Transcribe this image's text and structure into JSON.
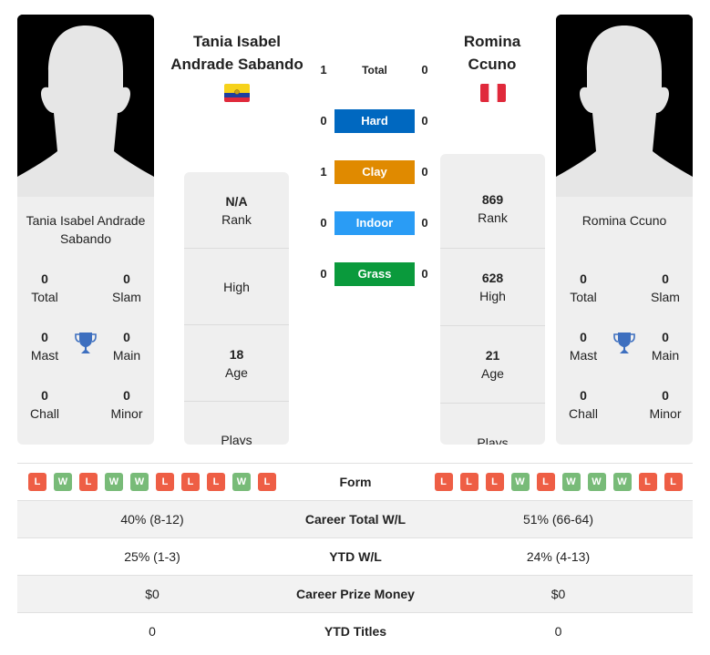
{
  "players": [
    {
      "head_name": "Tania Isabel Andrade Sabando",
      "head_name_lines": [
        "Tania Isabel",
        "Andrade Sabando"
      ],
      "card_name": "Tania Isabel Andrade Sabando",
      "country": "Ecuador",
      "flag_icon": "ecuador-flag-icon",
      "titles": {
        "total": {
          "value": "0",
          "label": "Total"
        },
        "slam": {
          "value": "0",
          "label": "Slam"
        },
        "mast": {
          "value": "0",
          "label": "Mast"
        },
        "main": {
          "value": "0",
          "label": "Main"
        },
        "chall": {
          "value": "0",
          "label": "Chall"
        },
        "minor": {
          "value": "0",
          "label": "Minor"
        }
      },
      "stats": {
        "rank": {
          "value": "N/A",
          "label": "Rank"
        },
        "high": {
          "value": "",
          "label": "High"
        },
        "age": {
          "value": "18",
          "label": "Age"
        },
        "plays": {
          "value": "",
          "label": "Plays"
        }
      },
      "form": [
        "L",
        "W",
        "L",
        "W",
        "W",
        "L",
        "L",
        "L",
        "W",
        "L"
      ],
      "career_wl": "40% (8-12)",
      "ytd_wl": "25% (1-3)",
      "prize_money": "$0",
      "ytd_titles": "0"
    },
    {
      "head_name": "Romina Ccuno",
      "head_name_lines": [
        "Romina",
        "Ccuno"
      ],
      "card_name": "Romina Ccuno",
      "country": "Peru",
      "flag_icon": "peru-flag-icon",
      "titles": {
        "total": {
          "value": "0",
          "label": "Total"
        },
        "slam": {
          "value": "0",
          "label": "Slam"
        },
        "mast": {
          "value": "0",
          "label": "Mast"
        },
        "main": {
          "value": "0",
          "label": "Main"
        },
        "chall": {
          "value": "0",
          "label": "Chall"
        },
        "minor": {
          "value": "0",
          "label": "Minor"
        }
      },
      "stats": {
        "rank": {
          "value": "869",
          "label": "Rank"
        },
        "high": {
          "value": "628",
          "label": "High"
        },
        "age": {
          "value": "21",
          "label": "Age"
        },
        "plays": {
          "value": "",
          "label": "Plays"
        }
      },
      "form": [
        "L",
        "L",
        "L",
        "W",
        "L",
        "W",
        "W",
        "W",
        "L",
        "L"
      ],
      "career_wl": "51% (66-64)",
      "ytd_wl": "24% (4-13)",
      "prize_money": "$0",
      "ytd_titles": "0"
    }
  ],
  "h2h": {
    "total": {
      "label": "Total",
      "left": "1",
      "right": "0"
    },
    "surfaces": [
      {
        "label": "Hard",
        "left": "0",
        "right": "0",
        "color": "#0068c0"
      },
      {
        "label": "Clay",
        "left": "1",
        "right": "0",
        "color": "#e08a00"
      },
      {
        "label": "Indoor",
        "left": "0",
        "right": "0",
        "color": "#2a9cf5"
      },
      {
        "label": "Grass",
        "left": "0",
        "right": "0",
        "color": "#0a9a3c"
      }
    ]
  },
  "comparison": {
    "form_label": "Form",
    "career_wl_label": "Career Total W/L",
    "ytd_wl_label": "YTD W/L",
    "prize_label": "Career Prize Money",
    "ytd_titles_label": "YTD Titles"
  },
  "colors": {
    "loss": "#ee5e45",
    "win": "#78bb78",
    "trophy": "#3d6fbf"
  }
}
